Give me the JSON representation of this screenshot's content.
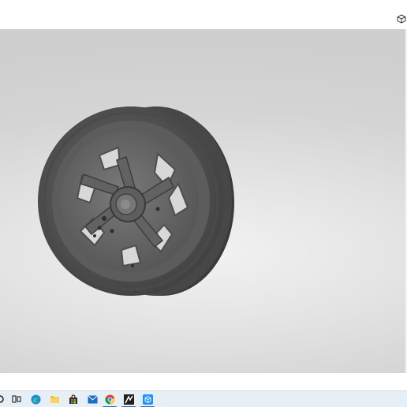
{
  "app": {
    "toolbar": {
      "view_cube_icon": "cube-icon"
    },
    "viewport": {
      "model": "wheel-rim-3d-model",
      "background_color": "#dcdcdc",
      "model_color": "#5a5a5a"
    }
  },
  "taskbar": {
    "background_color": "#e6eef6",
    "accent_color": "#2b6cc4",
    "icons": [
      {
        "name": "search-icon"
      },
      {
        "name": "edge-browser-icon"
      },
      {
        "name": "task-view-icon"
      },
      {
        "name": "file-explorer-icon"
      },
      {
        "name": "microsoft-store-icon"
      },
      {
        "name": "mail-icon"
      },
      {
        "name": "chrome-icon"
      },
      {
        "name": "drawing-app-icon"
      },
      {
        "name": "3d-viewer-icon"
      }
    ]
  }
}
